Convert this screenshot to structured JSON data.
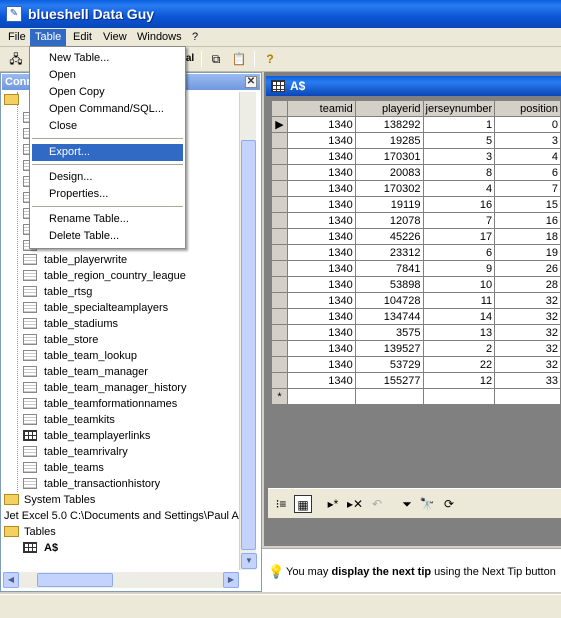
{
  "window": {
    "title": "blueshell Data Guy"
  },
  "menubar": {
    "items": [
      "File",
      "Table",
      "Edit",
      "View",
      "Windows",
      "?"
    ],
    "active": "Table"
  },
  "table_menu": {
    "groups": [
      [
        "New Table...",
        "Open",
        "Open Copy",
        "Open Command/SQL...",
        "Close"
      ],
      [
        "Export..."
      ],
      [
        "Design...",
        "Properties..."
      ],
      [
        "Rename Table...",
        "Delete Table..."
      ]
    ],
    "highlighted": "Export..."
  },
  "connections_panel": {
    "header": "Conn",
    "tables": [
      "table_playerwrite",
      "table_region_country_league",
      "table_rtsg",
      "table_specialteamplayers",
      "table_stadiums",
      "table_store",
      "table_team_lookup",
      "table_team_manager",
      "table_team_manager_history",
      "table_teamformationnames",
      "table_teamkits",
      "table_teamplayerlinks",
      "table_teamrivalry",
      "table_teams",
      "table_transactionhistory"
    ],
    "system_tables": "System Tables",
    "connection2": "Jet Excel 5.0 C:\\Documents and Settings\\Paul A",
    "tables_folder": "Tables",
    "excel_table": "A$"
  },
  "grid_window": {
    "title": "A$",
    "columns": [
      "teamid",
      "playerid",
      "jerseynumber",
      "position"
    ],
    "rows": [
      [
        "1340",
        "138292",
        "1",
        "0"
      ],
      [
        "1340",
        "19285",
        "5",
        "3"
      ],
      [
        "1340",
        "170301",
        "3",
        "4"
      ],
      [
        "1340",
        "20083",
        "8",
        "6"
      ],
      [
        "1340",
        "170302",
        "4",
        "7"
      ],
      [
        "1340",
        "19119",
        "16",
        "15"
      ],
      [
        "1340",
        "12078",
        "7",
        "16"
      ],
      [
        "1340",
        "45226",
        "17",
        "18"
      ],
      [
        "1340",
        "23312",
        "6",
        "19"
      ],
      [
        "1340",
        "7841",
        "9",
        "26"
      ],
      [
        "1340",
        "53898",
        "10",
        "28"
      ],
      [
        "1340",
        "104728",
        "11",
        "32"
      ],
      [
        "1340",
        "134744",
        "14",
        "32"
      ],
      [
        "1340",
        "3575",
        "13",
        "32"
      ],
      [
        "1340",
        "139527",
        "2",
        "32"
      ],
      [
        "1340",
        "53729",
        "22",
        "32"
      ],
      [
        "1340",
        "155277",
        "12",
        "33"
      ]
    ],
    "current_row_marker": "▶",
    "new_row_marker": "*"
  },
  "tip": {
    "prefix": "You may ",
    "bold": "display the next tip",
    "suffix": " using the Next Tip button"
  },
  "colors": {
    "title_blue": "#0a5fe0",
    "highlight": "#316ac5"
  }
}
